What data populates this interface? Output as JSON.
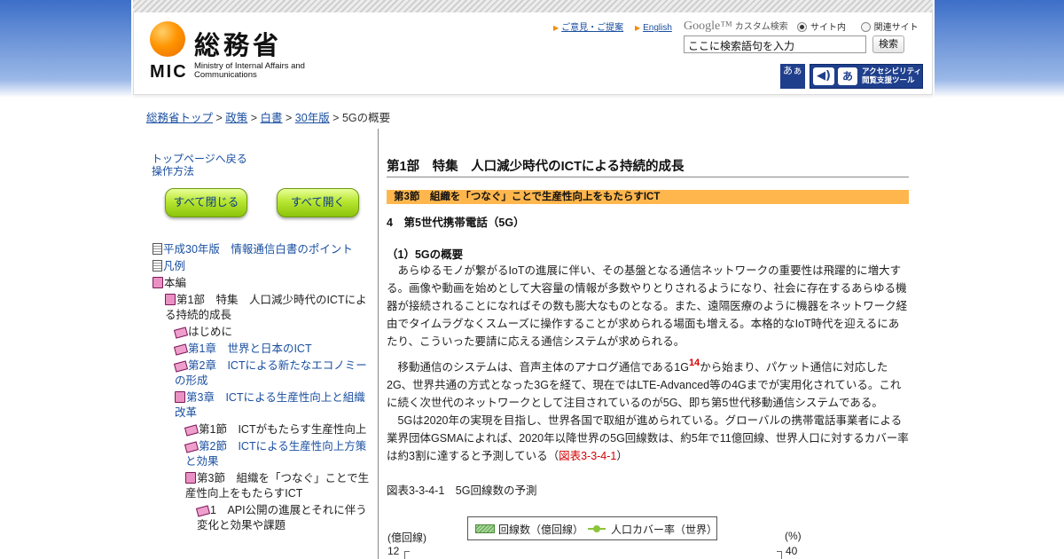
{
  "header": {
    "logo_jp": "総務省",
    "logo_mic": "MIC",
    "logo_en": "Ministry of Internal Affairs and Communications",
    "links": [
      "ご意見・ご提案",
      "English"
    ],
    "google": "Google™",
    "custom_search": "カスタム検索",
    "radio_site": "サイト内",
    "radio_related": "関連サイト",
    "search_placeholder": "ここに検索語句を入力",
    "search_button": "検索",
    "font_icon": "あぁ",
    "accessibility_a": "あ",
    "accessibility_label_1": "アクセシビリティ",
    "accessibility_label_2": "閲覧支援ツール"
  },
  "breadcrumb": {
    "items": [
      "総務省トップ",
      "政策",
      "白書",
      "30年版"
    ],
    "current": "5Gの概要",
    "sep": " > "
  },
  "sidebar": {
    "back_link": "トップページへ戻る",
    "howto_link": "操作方法",
    "close_all": "すべて閉じる",
    "open_all": "すべて開く",
    "tree": [
      "平成30年版　情報通信白書のポイント",
      "凡例",
      "本編",
      "第1部　特集　人口減少時代のICTによる持続的成長",
      "はじめに",
      "第1章　世界と日本のICT",
      "第2章　ICTによる新たなエコノミーの形成",
      "第3章　ICTによる生産性向上と組織改革",
      "第1節　ICTがもたらす生産性向上",
      "第2節　ICTによる生産性向上方策と効果",
      "第3節　組織を「つなぐ」ことで生産性向上をもたらすICT",
      "1　API公開の進展とそれに伴う変化と効果や課題"
    ]
  },
  "main": {
    "part_title": "第1部　特集　人口減少時代のICTによる持続的成長",
    "section_title": "第3節　組織を「つなぐ」ことで生産性向上をもたらすICT",
    "subsection": "4　第5世代携帯電話（5G）",
    "topic": "（1）5Gの概要",
    "para1": "　あらゆるモノが繋がるIoTの進展に伴い、その基盤となる通信ネットワークの重要性は飛躍的に増大する。画像や動画を始めとして大容量の情報が多数やりとりされるようになり、社会に存在するあらゆる機器が接続されることになればその数も膨大なものとなる。また、遠隔医療のように機器をネットワーク経由でタイムラグなくスムーズに操作することが求められる場面も増える。本格的なIoT時代を迎えるにあたり、こういった要請に応える通信システムが求められる。",
    "para2_a": "　移動通信のシステムは、音声主体のアナログ通信である1G",
    "para2_sup": "14",
    "para2_b": "から始まり、パケット通信に対応した2G、世界共通の方式となった3Gを経て、現在ではLTE-Advanced等の4Gまでが実用化されている。これに続く次世代のネットワークとして注目されているのが5G、即ち第5世代移動通信システムである。",
    "para3_a": "　5Gは2020年の実現を目指し、世界各国で取組が進められている。グローバルの携帯電話事業者による業界団体GSMAによれば、2020年以降世界の5G回線数は、約5年で11億回線、世界人口に対するカバー率は約3割に達すると予測している（",
    "para3_ref": "図表3-3-4-1",
    "para3_b": "）",
    "figure_caption": "図表3-3-4-1　5G回線数の予測"
  },
  "chart_data": {
    "type": "bar",
    "title": "5G回線数の予測",
    "series": [
      {
        "name": "回線数（億回線）"
      },
      {
        "name": "人口カバー率（世界）"
      }
    ],
    "ylabel": "(億回線)",
    "y2label": "(%)",
    "y_ticks_visible": [
      "12"
    ],
    "y2_ticks_visible": [
      "40"
    ]
  },
  "colors": {
    "link": "#1a4fa0",
    "section_bar": "#ffb74d",
    "accent_red": "#d40000",
    "series_bar": "#5a9a4a",
    "series_line": "#8cc43a"
  }
}
